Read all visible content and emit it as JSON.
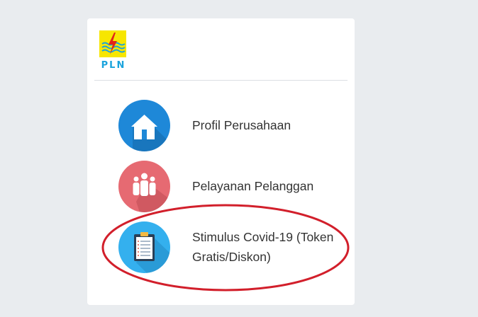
{
  "brand": {
    "logo_text": "PLN",
    "logo_bg": "#f7e600",
    "logo_text_color": "#1aa3dc"
  },
  "menu": {
    "items": [
      {
        "label": "Profil Perusahaan",
        "icon": "house-icon",
        "color": "#1e88d8"
      },
      {
        "label": "Pelayanan Pelanggan",
        "icon": "people-icon",
        "color": "#e66a72"
      },
      {
        "label": "Stimulus Covid-19 (Token Gratis/Diskon)",
        "icon": "clipboard-icon",
        "color": "#34b0ee"
      }
    ]
  },
  "annotation": {
    "color": "#d21f2b",
    "shape": "ellipse"
  }
}
